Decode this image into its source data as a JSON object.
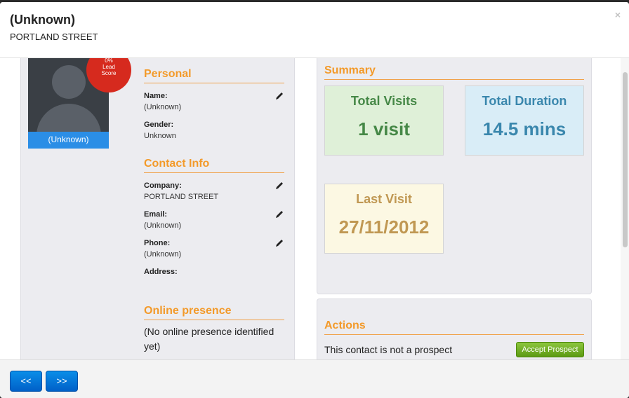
{
  "header": {
    "title": "(Unknown)",
    "subtitle": "PORTLAND STREET",
    "close_glyph": "×"
  },
  "profile": {
    "avatar_name": "(Unknown)",
    "lead_score": {
      "percent": "0%",
      "line1": "Lead",
      "line2": "Score"
    }
  },
  "personal": {
    "heading": "Personal",
    "fields": [
      {
        "label": "Name:",
        "value": "(Unknown)"
      },
      {
        "label": "Gender:",
        "value": "Unknown"
      }
    ]
  },
  "contact": {
    "heading": "Contact Info",
    "fields": [
      {
        "label": "Company:",
        "value": "PORTLAND STREET"
      },
      {
        "label": "Email:",
        "value": "(Unknown)"
      },
      {
        "label": "Phone:",
        "value": "(Unknown)"
      },
      {
        "label": "Address:",
        "value": ""
      }
    ]
  },
  "online": {
    "heading": "Online presence",
    "text": "(No online presence identified yet)"
  },
  "summary": {
    "heading": "Summary",
    "tiles": [
      {
        "title": "Total Visits",
        "value": "1 visit"
      },
      {
        "title": "Total Duration",
        "value": "14.5 mins"
      },
      {
        "title": "Last Visit",
        "value": "27/11/2012"
      }
    ]
  },
  "actions": {
    "heading": "Actions",
    "text": "This contact is not a prospect",
    "button": "Accept Prospect"
  },
  "footer": {
    "prev": "<<",
    "next": ">>"
  },
  "icons": {
    "edit": "pencil-icon",
    "close": "close-icon"
  },
  "colors": {
    "section_heading": "#f39a2a",
    "lead_score": "#d62a1e",
    "avatar_bar": "#2b8ee6",
    "accept": "#6aaa1e",
    "nav_button": "#0a7ad8"
  }
}
